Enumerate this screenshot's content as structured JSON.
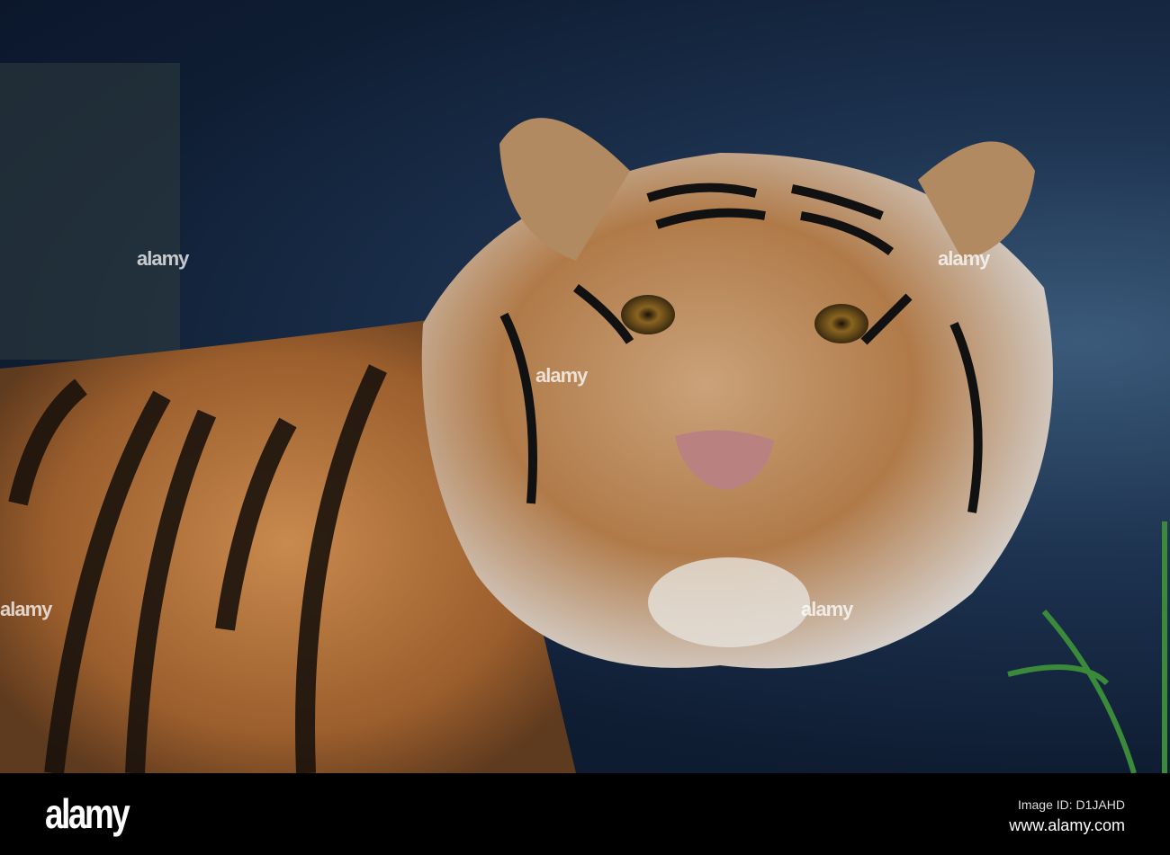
{
  "photo": {
    "subject": "tiger",
    "watermark_text": "alamy"
  },
  "footer": {
    "logo": "alamy",
    "image_id": "Image ID: D1JAHD",
    "website": "www.alamy.com"
  }
}
